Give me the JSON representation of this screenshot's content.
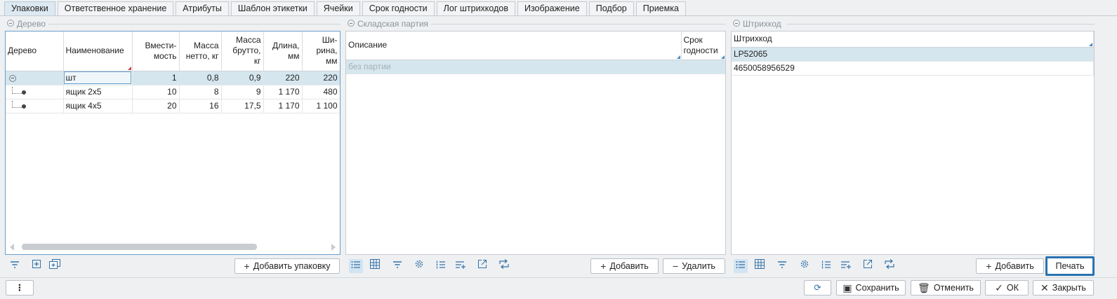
{
  "tabs": [
    "Упаковки",
    "Ответственное хранение",
    "Атрибуты",
    "Шаблон этикетки",
    "Ячейки",
    "Срок годности",
    "Лог штрихкодов",
    "Изображение",
    "Подбор",
    "Приемка"
  ],
  "active_tab": 0,
  "tree_panel": {
    "title": "Дерево",
    "headers": {
      "tree": "Дерево",
      "name": "Наименование",
      "capacity": "Вмести-\nмость",
      "net": "Масса\nнетто, кг",
      "gross": "Масса\nбрутто, кг",
      "length": "Длина,\nмм",
      "width": "Ши-\nрина,\nмм"
    },
    "rows": [
      {
        "name": "шт",
        "capacity": "1",
        "net": "0,8",
        "gross": "0,9",
        "length": "220",
        "width": "220"
      },
      {
        "name": "ящик 2х5",
        "capacity": "10",
        "net": "8",
        "gross": "9",
        "length": "1 170",
        "width": "480"
      },
      {
        "name": "ящик 4х5",
        "capacity": "20",
        "net": "16",
        "gross": "17,5",
        "length": "1 170",
        "width": "1 100"
      }
    ],
    "add_button": "Добавить упаковку"
  },
  "batch_panel": {
    "title": "Складская партия",
    "headers": {
      "desc": "Описание",
      "expiry": "Срок\nгодности"
    },
    "rows": [
      {
        "desc": "без партии",
        "expiry": ""
      }
    ],
    "add_button": "Добавить",
    "delete_button": "Удалить"
  },
  "barcode_panel": {
    "title": "Штрихкод",
    "header": "Штрихкод",
    "rows": [
      "LP52065",
      "4650058956529"
    ],
    "add_button": "Добавить",
    "print_button": "Печать"
  },
  "footer": {
    "menu": "⋮",
    "save": "Сохранить",
    "cancel": "Отменить",
    "ok": "ОК",
    "close": "Закрыть"
  }
}
